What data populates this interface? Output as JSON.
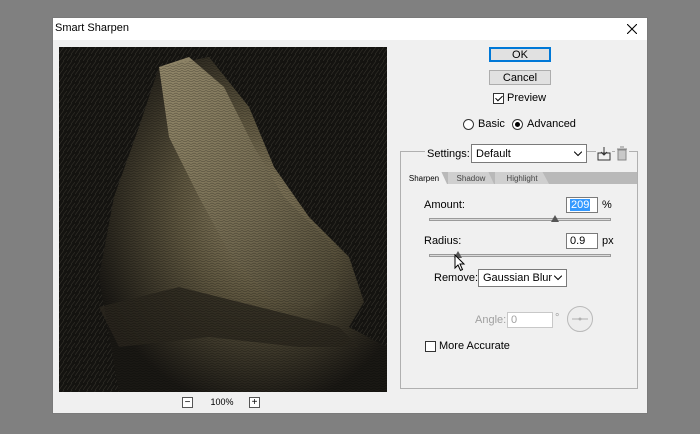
{
  "window": {
    "title": "Smart Sharpen"
  },
  "buttons": {
    "ok": "OK",
    "cancel": "Cancel"
  },
  "preview_check": {
    "label": "Preview",
    "checked": true
  },
  "mode": {
    "basic": "Basic",
    "advanced": "Advanced",
    "selected": "Advanced"
  },
  "settings": {
    "label": "Settings:",
    "value": "Default"
  },
  "tabs": [
    {
      "label": "Sharpen",
      "active": true
    },
    {
      "label": "Shadow",
      "active": false
    },
    {
      "label": "Highlight",
      "active": false
    }
  ],
  "amount": {
    "label": "Amount:",
    "value": "209",
    "unit": "%",
    "level": 0.69
  },
  "radius": {
    "label": "Radius:",
    "value": "0.9",
    "unit": "px",
    "level": 0.16
  },
  "remove": {
    "label": "Remove:",
    "value": "Gaussian Blur"
  },
  "angle": {
    "label": "Angle:",
    "value": "0",
    "unit": "°"
  },
  "more_accurate": {
    "label": "More Accurate",
    "checked": false
  },
  "zoom": {
    "level": "100%",
    "minus": "−",
    "plus": "+"
  },
  "icons": [
    "close-icon",
    "save-preset-icon",
    "delete-preset-icon",
    "chevron-down-icon",
    "cursor-icon",
    "zoom-out-icon",
    "zoom-in-icon"
  ],
  "colors": {
    "canvas": "#808080",
    "dialog": "#f0f0f0",
    "accent": "#0078d7",
    "selection": "#3399ff"
  }
}
